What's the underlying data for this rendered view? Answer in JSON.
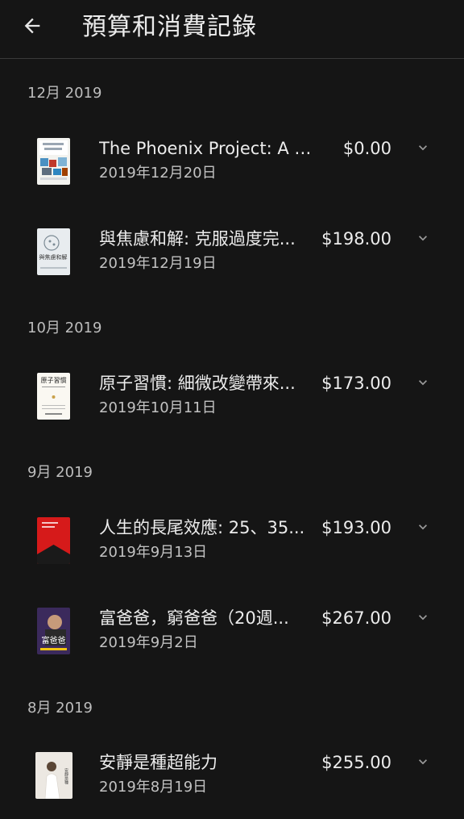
{
  "app_bar": {
    "title": "預算和消費記錄",
    "back_icon": "arrow-back-icon"
  },
  "colors": {
    "background": "#151515",
    "text_primary": "#ececec",
    "text_secondary": "#c2c2c2",
    "divider": "#3a3a3a"
  },
  "sections": [
    {
      "label": "12月 2019",
      "items": [
        {
          "title": "The Phoenix Project: A N...",
          "price": "$0.00",
          "date": "2019年12月20日",
          "cover": "book-cover-phoenix-project"
        },
        {
          "title": "與焦慮和解: 克服過度完...",
          "price": "$198.00",
          "date": "2019年12月19日",
          "cover": "book-cover-anxiety"
        }
      ]
    },
    {
      "label": "10月 2019",
      "items": [
        {
          "title": "原子習慣: 細微改變帶來...",
          "price": "$173.00",
          "date": "2019年10月11日",
          "cover": "book-cover-atomic-habits"
        }
      ]
    },
    {
      "label": "9月 2019",
      "items": [
        {
          "title": "人生的長尾效應: 25、35...",
          "price": "$193.00",
          "date": "2019年9月13日",
          "cover": "book-cover-long-tail"
        },
        {
          "title": "富爸爸，窮爸爸（20週...",
          "price": "$267.00",
          "date": "2019年9月2日",
          "cover": "book-cover-rich-dad"
        }
      ]
    },
    {
      "label": "8月 2019",
      "items": [
        {
          "title": "安靜是種超能力",
          "price": "$255.00",
          "date": "2019年8月19日",
          "cover": "book-cover-quiet-power"
        }
      ]
    }
  ],
  "cover_texts": {
    "anxiety": "與焦慮和解",
    "atomic": "原子習慣",
    "richdad": "富爸爸",
    "quiet": "安靜是種"
  }
}
